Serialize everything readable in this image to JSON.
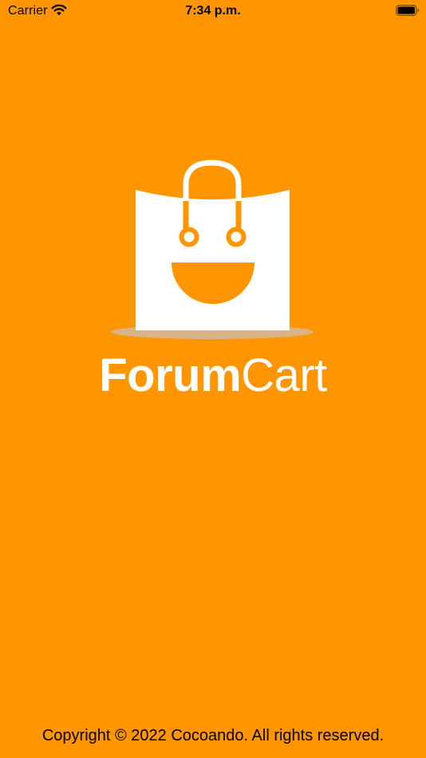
{
  "status_bar": {
    "carrier": "Carrier",
    "time": "7:34 p.m.",
    "wifi_icon": "wifi-icon",
    "battery_icon": "battery-icon"
  },
  "splash": {
    "background_color": "#FF9500",
    "logo_icon": "smiling-shopping-bag-icon",
    "brand_part_bold": "Forum",
    "brand_part_light": "Cart",
    "brand_text_color": "#FFFFFF",
    "copyright": "Copyright © 2022 Cocoando. All rights reserved."
  }
}
